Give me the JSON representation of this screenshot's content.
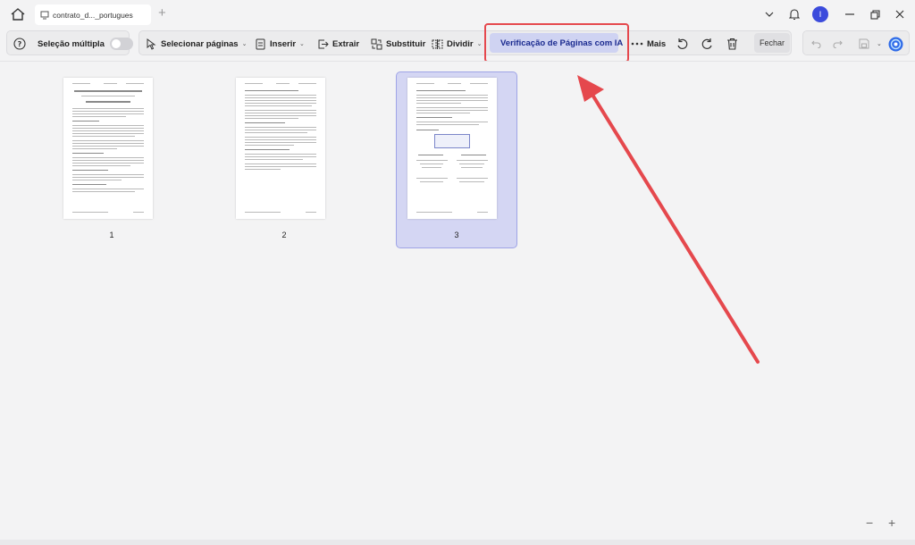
{
  "titlebar": {
    "tab_title": "contrato_d..._portugues",
    "avatar_initial": "I"
  },
  "toolbar": {
    "multi_select_label": "Seleção múltipla",
    "select_pages_label": "Selecionar páginas",
    "insert_label": "Inserir",
    "extract_label": "Extrair",
    "replace_label": "Substituir",
    "split_label": "Dividir",
    "ai_check_label": "Verificação de Páginas com IA",
    "more_label": "Mais",
    "close_label": "Fechar"
  },
  "pages": [
    {
      "number": "1",
      "selected": false
    },
    {
      "number": "2",
      "selected": false
    },
    {
      "number": "3",
      "selected": true
    }
  ],
  "zoom": {
    "out_label": "−",
    "in_label": "+"
  },
  "colors": {
    "accent": "#3b4bdc",
    "highlight": "#e5484d",
    "selection": "#d4d6f3"
  }
}
